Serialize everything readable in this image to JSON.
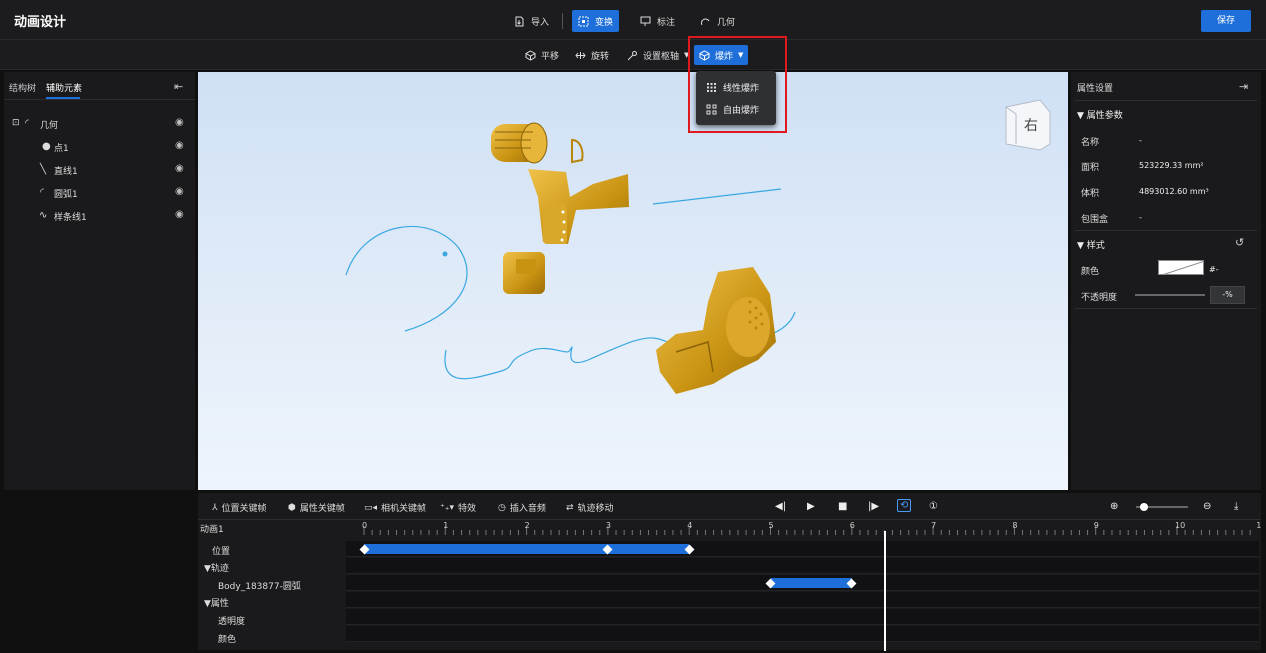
{
  "app": {
    "title": "动画设计",
    "save_label": "保存"
  },
  "toolbar": {
    "import": "导入",
    "transform": "变换",
    "annotate": "标注",
    "geometry": "几何"
  },
  "subtoolbar": {
    "translate": "平移",
    "rotate": "旋转",
    "set_pivot": "设置枢轴",
    "explode": "爆炸"
  },
  "explode_menu": {
    "linear": "线性爆炸",
    "free": "自由爆炸"
  },
  "left_panel": {
    "tabs": [
      "结构树",
      "辅助元素"
    ],
    "tree": {
      "root": "几何",
      "items": [
        "点1",
        "直线1",
        "圆弧1",
        "样条线1"
      ]
    }
  },
  "viewcube": {
    "label": "右"
  },
  "right_panel": {
    "title": "属性设置",
    "section_params": "属性参数",
    "name_label": "名称",
    "name_value": "-",
    "area_label": "面积",
    "area_value": "523229.33 mm²",
    "volume_label": "体积",
    "volume_value": "4893012.60 mm³",
    "bbox_label": "包围盒",
    "bbox_value": "-",
    "section_style": "样式",
    "color_label": "颜色",
    "color_value": "#-",
    "opacity_label": "不透明度",
    "opacity_value": "-%"
  },
  "timeline": {
    "toolbar": {
      "pos_keyframe": "位置关键帧",
      "attr_keyframe": "属性关键帧",
      "camera_keyframe": "相机关键帧",
      "effects": "特效",
      "insert_audio": "插入音频",
      "track_move": "轨迹移动"
    },
    "animation_name": "动画1",
    "ticks": [
      "0",
      "1",
      "2",
      "3",
      "4",
      "5",
      "6",
      "7",
      "8",
      "9",
      "10",
      "1"
    ],
    "rows": {
      "position": "位置",
      "trajectory": "▼轨迹",
      "trajectory_item": "Body_183877-圆弧",
      "attributes": "▼属性",
      "opacity": "透明度",
      "color": "颜色"
    },
    "position_keyframes": [
      0,
      3,
      4
    ],
    "trajectory_keyframes": [
      5,
      6
    ],
    "playhead": 6.4
  },
  "colors": {
    "accent": "#1e6fd9",
    "part": "#d4a017",
    "curve": "#3aa8e0",
    "highlight": "#e0191f"
  }
}
